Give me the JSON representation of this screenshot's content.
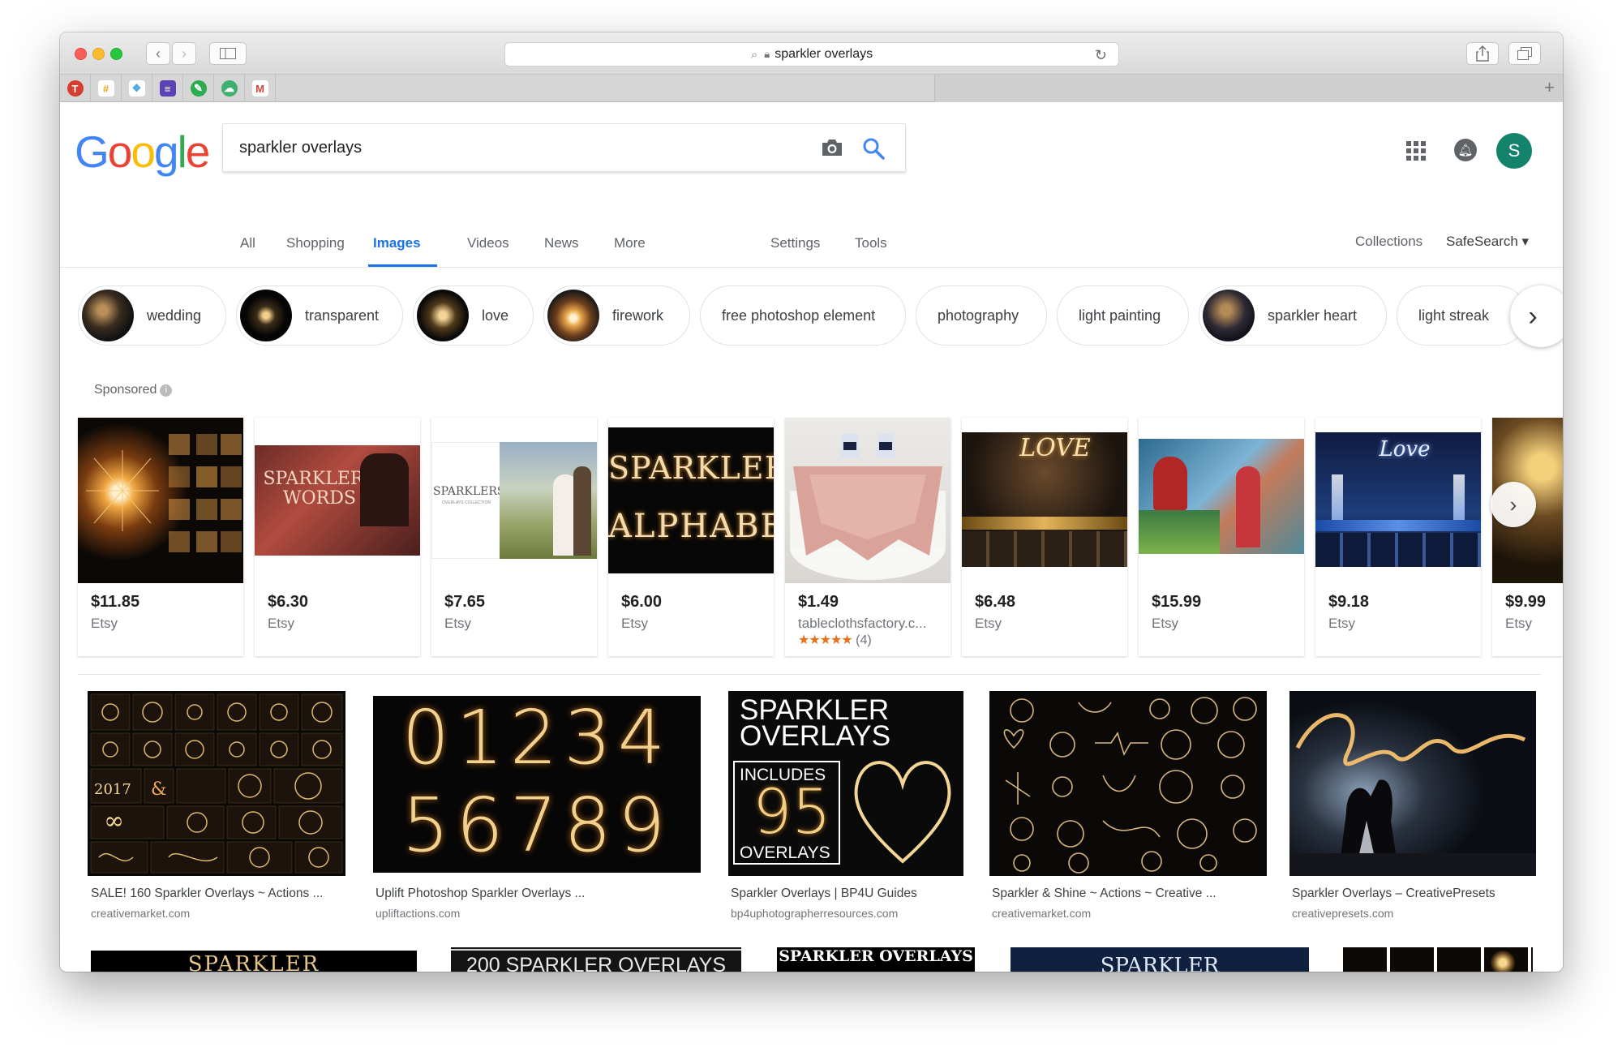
{
  "browser": {
    "address": "sparkler overlays",
    "bookmarks": [
      {
        "icon": "T",
        "color": "#d63c2f",
        "name": "bookmark-t-icon"
      },
      {
        "icon": "#",
        "color": "#e8a319",
        "name": "bookmark-slack-icon"
      },
      {
        "icon": "❖",
        "color": "#4aa5e0",
        "name": "bookmark-puzzle-icon"
      },
      {
        "icon": "≡",
        "color": "#5b43b6",
        "name": "bookmark-list-icon"
      },
      {
        "icon": "✎",
        "color": "#2dab4f",
        "name": "bookmark-evernote-icon"
      },
      {
        "icon": "☁",
        "color": "#3db16d",
        "name": "bookmark-cloud-icon"
      },
      {
        "icon": "M",
        "color": "#ffffff",
        "name": "bookmark-gmail-icon"
      }
    ]
  },
  "search": {
    "query": "sparkler overlays"
  },
  "header": {
    "avatar_initial": "S"
  },
  "tabs": {
    "all": "All",
    "shopping": "Shopping",
    "images": "Images",
    "videos": "Videos",
    "news": "News",
    "more": "More",
    "settings": "Settings",
    "tools": "Tools",
    "collections": "Collections",
    "safesearch": "SafeSearch ▾"
  },
  "chips": [
    {
      "label": "wedding",
      "has_thumb": true
    },
    {
      "label": "transparent",
      "has_thumb": true
    },
    {
      "label": "love",
      "has_thumb": true
    },
    {
      "label": "firework",
      "has_thumb": true
    },
    {
      "label": "free photoshop element",
      "has_thumb": false
    },
    {
      "label": "photography",
      "has_thumb": false
    },
    {
      "label": "light painting",
      "has_thumb": false
    },
    {
      "label": "sparkler heart",
      "has_thumb": true
    },
    {
      "label": "light streak",
      "has_thumb": false
    }
  ],
  "sponsored": {
    "label": "Sponsored",
    "products": [
      {
        "price": "$11.85",
        "store": "Etsy"
      },
      {
        "price": "$6.30",
        "store": "Etsy"
      },
      {
        "price": "$7.65",
        "store": "Etsy"
      },
      {
        "price": "$6.00",
        "store": "Etsy"
      },
      {
        "price": "$1.49",
        "store": "tableclothsfactory.c...",
        "rating": "★★★★★",
        "reviews": "(4)"
      },
      {
        "price": "$6.48",
        "store": "Etsy"
      },
      {
        "price": "$15.99",
        "store": "Etsy"
      },
      {
        "price": "$9.18",
        "store": "Etsy"
      },
      {
        "price": "$9.99",
        "store": "Etsy"
      }
    ]
  },
  "image_texts": {
    "sparklers_words": "SPARKLERS WORDS",
    "sparklers_collection": "SPARKLERS",
    "collection_sub": "OVERLAYS COLLECTION",
    "alphabet_1": "SPARKLERS",
    "alphabet_2": "ALPHABET",
    "love": "LOVE",
    "digits_1": "01234",
    "digits_2": "56789",
    "overlays_1": "SPARKLER",
    "overlays_2": "OVERLAYS",
    "includes": "INCLUDES",
    "ninety_five": "95",
    "overlays_3": "OVERLAYS",
    "love_script": "Love",
    "bottom_1": "SPARKLER",
    "bottom_2": "200 SPARKLER OVERLAYS",
    "bottom_3": "SPARKLER OVERLAYS",
    "bottom_4": "SPARKLER"
  },
  "results": [
    {
      "title": "SALE! 160 Sparkler Overlays ~ Actions ...",
      "source": "creativemarket.com"
    },
    {
      "title": "Uplift Photoshop Sparkler Overlays ...",
      "source": "upliftactions.com"
    },
    {
      "title": "Sparkler Overlays | BP4U Guides",
      "source": "bp4uphotographerresources.com"
    },
    {
      "title": "Sparkler & Shine ~ Actions ~ Creative ...",
      "source": "creativemarket.com"
    },
    {
      "title": "Sparkler Overlays – CreativePresets",
      "source": "creativepresets.com"
    }
  ]
}
